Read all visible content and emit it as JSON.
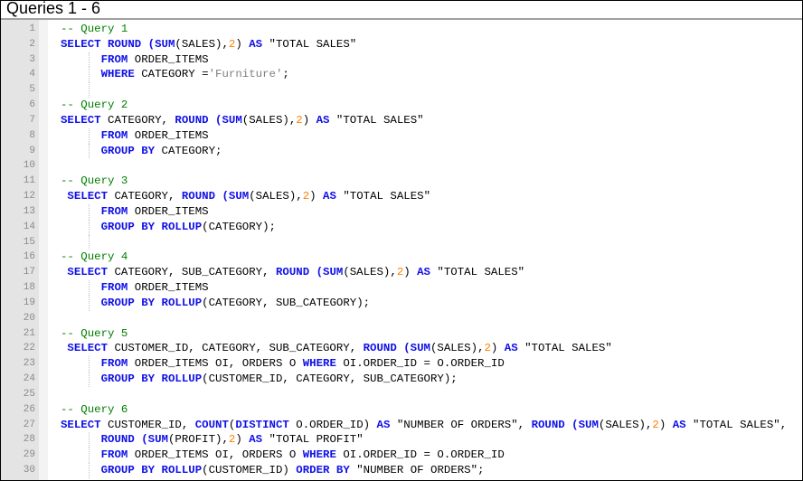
{
  "title": "Queries 1 - 6",
  "lines": [
    {
      "n": "1",
      "guide": false,
      "tokens": [
        [
          "cm",
          "-- Query 1"
        ]
      ]
    },
    {
      "n": "2",
      "guide": false,
      "tokens": [
        [
          "kw",
          "SELECT ROUND "
        ],
        [
          "",
          ""
        ],
        [
          "kw",
          "(SUM"
        ],
        [
          "",
          "(SALES),"
        ],
        [
          "num",
          "2"
        ],
        [
          "",
          ") "
        ],
        [
          "kw",
          "AS"
        ],
        [
          "",
          " \"TOTAL SALES\""
        ]
      ]
    },
    {
      "n": "3",
      "guide": true,
      "tokens": [
        [
          "",
          "      "
        ],
        [
          "kw",
          "FROM"
        ],
        [
          "",
          " ORDER_ITEMS"
        ]
      ]
    },
    {
      "n": "4",
      "guide": true,
      "tokens": [
        [
          "",
          "      "
        ],
        [
          "kw",
          "WHERE"
        ],
        [
          "",
          " CATEGORY ="
        ],
        [
          "str",
          "'Furniture'"
        ],
        [
          "",
          ";"
        ]
      ]
    },
    {
      "n": "5",
      "guide": true,
      "tokens": []
    },
    {
      "n": "6",
      "guide": false,
      "tokens": [
        [
          "cm",
          "-- Query 2"
        ]
      ]
    },
    {
      "n": "7",
      "guide": false,
      "tokens": [
        [
          "kw",
          "SELECT"
        ],
        [
          "",
          " CATEGORY, "
        ],
        [
          "kw",
          "ROUND (SUM"
        ],
        [
          "",
          "(SALES),"
        ],
        [
          "num",
          "2"
        ],
        [
          "",
          ") "
        ],
        [
          "kw",
          "AS"
        ],
        [
          "",
          " \"TOTAL SALES\""
        ]
      ]
    },
    {
      "n": "8",
      "guide": true,
      "tokens": [
        [
          "",
          "      "
        ],
        [
          "kw",
          "FROM"
        ],
        [
          "",
          " ORDER_ITEMS"
        ]
      ]
    },
    {
      "n": "9",
      "guide": true,
      "tokens": [
        [
          "",
          "      "
        ],
        [
          "kw",
          "GROUP BY"
        ],
        [
          "",
          " CATEGORY;"
        ]
      ]
    },
    {
      "n": "10",
      "guide": false,
      "tokens": []
    },
    {
      "n": "11",
      "guide": false,
      "tokens": [
        [
          "cm",
          "-- Query 3"
        ]
      ]
    },
    {
      "n": "12",
      "guide": false,
      "tokens": [
        [
          "kw",
          " SELECT"
        ],
        [
          "",
          " CATEGORY, "
        ],
        [
          "kw",
          "ROUND (SUM"
        ],
        [
          "",
          "(SALES),"
        ],
        [
          "num",
          "2"
        ],
        [
          "",
          ") "
        ],
        [
          "kw",
          "AS"
        ],
        [
          "",
          " \"TOTAL SALES\""
        ]
      ]
    },
    {
      "n": "13",
      "guide": true,
      "tokens": [
        [
          "",
          "      "
        ],
        [
          "kw",
          "FROM"
        ],
        [
          "",
          " ORDER_ITEMS"
        ]
      ]
    },
    {
      "n": "14",
      "guide": true,
      "tokens": [
        [
          "",
          "      "
        ],
        [
          "kw",
          "GROUP BY ROLLUP"
        ],
        [
          "",
          "(CATEGORY);"
        ]
      ]
    },
    {
      "n": "15",
      "guide": true,
      "tokens": []
    },
    {
      "n": "16",
      "guide": false,
      "tokens": [
        [
          "cm",
          "-- Query 4"
        ]
      ]
    },
    {
      "n": "17",
      "guide": false,
      "tokens": [
        [
          "kw",
          " SELECT"
        ],
        [
          "",
          " CATEGORY, SUB_CATEGORY, "
        ],
        [
          "kw",
          "ROUND (SUM"
        ],
        [
          "",
          "(SALES),"
        ],
        [
          "num",
          "2"
        ],
        [
          "",
          ") "
        ],
        [
          "kw",
          "AS"
        ],
        [
          "",
          " \"TOTAL SALES\""
        ]
      ]
    },
    {
      "n": "18",
      "guide": true,
      "tokens": [
        [
          "",
          "      "
        ],
        [
          "kw",
          "FROM"
        ],
        [
          "",
          " ORDER_ITEMS"
        ]
      ]
    },
    {
      "n": "19",
      "guide": true,
      "tokens": [
        [
          "",
          "      "
        ],
        [
          "kw",
          "GROUP BY ROLLUP"
        ],
        [
          "",
          "(CATEGORY, SUB_CATEGORY);"
        ]
      ]
    },
    {
      "n": "20",
      "guide": false,
      "tokens": []
    },
    {
      "n": "21",
      "guide": false,
      "tokens": [
        [
          "cm",
          "-- Query 5"
        ]
      ]
    },
    {
      "n": "22",
      "guide": false,
      "tokens": [
        [
          "kw",
          " SELECT"
        ],
        [
          "",
          " CUSTOMER_ID, CATEGORY, SUB_CATEGORY, "
        ],
        [
          "kw",
          "ROUND (SUM"
        ],
        [
          "",
          "(SALES),"
        ],
        [
          "num",
          "2"
        ],
        [
          "",
          ") "
        ],
        [
          "kw",
          "AS"
        ],
        [
          "",
          " \"TOTAL SALES\""
        ]
      ]
    },
    {
      "n": "23",
      "guide": true,
      "tokens": [
        [
          "",
          "      "
        ],
        [
          "kw",
          "FROM"
        ],
        [
          "",
          " ORDER_ITEMS OI, ORDERS O "
        ],
        [
          "kw",
          "WHERE"
        ],
        [
          "",
          " OI.ORDER_ID = O.ORDER_ID"
        ]
      ]
    },
    {
      "n": "24",
      "guide": true,
      "tokens": [
        [
          "",
          "      "
        ],
        [
          "kw",
          "GROUP BY ROLLUP"
        ],
        [
          "",
          "(CUSTOMER_ID, CATEGORY, SUB_CATEGORY);"
        ]
      ]
    },
    {
      "n": "25",
      "guide": false,
      "tokens": []
    },
    {
      "n": "26",
      "guide": false,
      "tokens": [
        [
          "cm",
          "-- Query 6"
        ]
      ]
    },
    {
      "n": "27",
      "guide": false,
      "tokens": [
        [
          "kw",
          "SELECT"
        ],
        [
          "",
          " CUSTOMER_ID, "
        ],
        [
          "kw",
          "COUNT"
        ],
        [
          "",
          "("
        ],
        [
          "kw",
          "DISTINCT"
        ],
        [
          "",
          " O.ORDER_ID) "
        ],
        [
          "kw",
          "AS"
        ],
        [
          "",
          " \"NUMBER OF ORDERS\", "
        ],
        [
          "kw",
          "ROUND (SUM"
        ],
        [
          "",
          "(SALES),"
        ],
        [
          "num",
          "2"
        ],
        [
          "",
          ") "
        ],
        [
          "kw",
          "AS"
        ],
        [
          "",
          " \"TOTAL SALES\","
        ]
      ]
    },
    {
      "n": "28",
      "guide": true,
      "tokens": [
        [
          "",
          "      "
        ],
        [
          "kw",
          "ROUND (SUM"
        ],
        [
          "",
          "(PROFIT),"
        ],
        [
          "num",
          "2"
        ],
        [
          "",
          ") "
        ],
        [
          "kw",
          "AS"
        ],
        [
          "",
          " \"TOTAL PROFIT\""
        ]
      ]
    },
    {
      "n": "29",
      "guide": true,
      "tokens": [
        [
          "",
          "      "
        ],
        [
          "kw",
          "FROM"
        ],
        [
          "",
          " ORDER_ITEMS OI, ORDERS O "
        ],
        [
          "kw",
          "WHERE"
        ],
        [
          "",
          " OI.ORDER_ID = O.ORDER_ID"
        ]
      ]
    },
    {
      "n": "30",
      "guide": true,
      "tokens": [
        [
          "",
          "      "
        ],
        [
          "kw",
          "GROUP BY ROLLUP"
        ],
        [
          "",
          "(CUSTOMER_ID) "
        ],
        [
          "kw",
          "ORDER BY"
        ],
        [
          "",
          " \"NUMBER OF ORDERS\";"
        ]
      ]
    }
  ]
}
